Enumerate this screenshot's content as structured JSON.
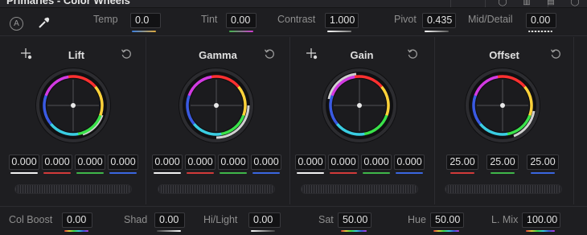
{
  "title": "Primaries - Color Wheels",
  "header_icons": [
    "target-icon",
    "waveform-icon",
    "log-icon",
    "more-icon"
  ],
  "top_controls": {
    "auto_label": "A",
    "temp": {
      "label": "Temp",
      "value": "0.0"
    },
    "tint": {
      "label": "Tint",
      "value": "0.00"
    },
    "contrast": {
      "label": "Contrast",
      "value": "1.000"
    },
    "pivot": {
      "label": "Pivot",
      "value": "0.435"
    },
    "mid_detail": {
      "label": "Mid/Detail",
      "value": "0.00"
    }
  },
  "wheels": [
    {
      "name": "Lift",
      "values": [
        "0.000",
        "0.000",
        "0.000",
        "0.000"
      ]
    },
    {
      "name": "Gamma",
      "values": [
        "0.000",
        "0.000",
        "0.000",
        "0.000"
      ]
    },
    {
      "name": "Gain",
      "values": [
        "0.000",
        "0.000",
        "0.000",
        "0.000"
      ]
    },
    {
      "name": "Offset",
      "values": [
        "25.00",
        "25.00",
        "25.00"
      ]
    }
  ],
  "bottom_controls": {
    "col_boost": {
      "label": "Col Boost",
      "value": "0.00"
    },
    "shad": {
      "label": "Shad",
      "value": "0.00"
    },
    "hi_light": {
      "label": "Hi/Light",
      "value": "0.00"
    },
    "sat": {
      "label": "Sat",
      "value": "50.00"
    },
    "hue": {
      "label": "Hue",
      "value": "50.00"
    },
    "l_mix": {
      "label": "L. Mix",
      "value": "100.00"
    }
  },
  "colors": {
    "channel_y": "#f2f2f2",
    "channel_r": "#d23a3a",
    "channel_g": "#3fb64a",
    "channel_b": "#3a66e0"
  }
}
